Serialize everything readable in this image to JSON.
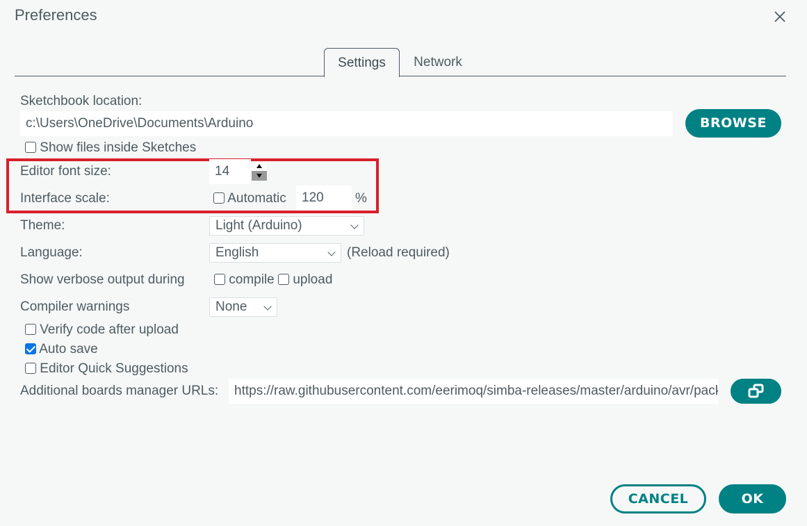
{
  "window": {
    "title": "Preferences",
    "close_icon": "close-icon"
  },
  "tabs": [
    {
      "label": "Settings",
      "active": true
    },
    {
      "label": "Network",
      "active": false
    }
  ],
  "settings": {
    "sketchbook": {
      "label": "Sketchbook location:",
      "value": "c:\\Users\\OneDrive\\Documents\\Arduino",
      "browse_label": "BROWSE"
    },
    "show_files": {
      "label": "Show files inside Sketches",
      "checked": false
    },
    "editor_font_size": {
      "label": "Editor font size:",
      "value": "14"
    },
    "interface_scale": {
      "label": "Interface scale:",
      "automatic_label": "Automatic",
      "automatic_checked": false,
      "value": "120",
      "unit": "%"
    },
    "theme": {
      "label": "Theme:",
      "selected": "Light (Arduino)"
    },
    "language": {
      "label": "Language:",
      "selected": "English",
      "note": "(Reload required)"
    },
    "verbose": {
      "label": "Show verbose output during",
      "compile_label": "compile",
      "compile_checked": false,
      "upload_label": "upload",
      "upload_checked": false
    },
    "compiler_warnings": {
      "label": "Compiler warnings",
      "selected": "None"
    },
    "verify_after_upload": {
      "label": "Verify code after upload",
      "checked": false
    },
    "auto_save": {
      "label": "Auto save",
      "checked": true
    },
    "quick_suggestions": {
      "label": "Editor Quick Suggestions",
      "checked": false
    },
    "boards_urls": {
      "label": "Additional boards manager URLs:",
      "value": "https://raw.githubusercontent.com/eerimoq/simba-releases/master/arduino/avr/package_simba_avr_index.json",
      "edit_icon": "open-window-icon"
    }
  },
  "footer": {
    "cancel_label": "CANCEL",
    "ok_label": "OK"
  },
  "colors": {
    "accent": "#008184",
    "highlight": "#d9202b",
    "checkbox_checked": "#0b75e5"
  }
}
